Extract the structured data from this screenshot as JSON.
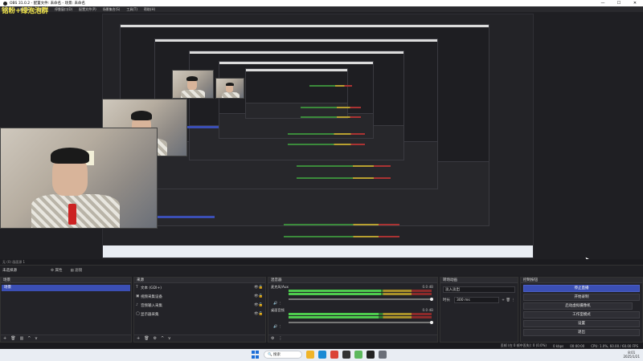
{
  "window": {
    "title": "OBS 31.0.2 - 配置文件: 未命名 - 场景: 未命名",
    "controls": [
      "—",
      "☐",
      "✕"
    ]
  },
  "menu": {
    "items": [
      "文件(F)",
      "编辑(E)",
      "视图(V)",
      "停靠窗口(D)",
      "配置文件(P)",
      "场景集合(S)",
      "工具(T)",
      "帮助(H)"
    ]
  },
  "overlay": {
    "small_text": "",
    "main_text": "铭粉+绿泡泡群"
  },
  "scene_bar": {
    "text": "无 (0) 画面源 1"
  },
  "mode_bar": {
    "label": "未选择源",
    "properties_label": "属性",
    "filters_label": "滤镜"
  },
  "scenes_dock": {
    "title": "场景",
    "items": [
      "场景"
    ],
    "footer": [
      "+",
      "🗑",
      "▥",
      "^",
      "v"
    ]
  },
  "sources_dock": {
    "title": "来源",
    "items": [
      {
        "icon": "T",
        "name": "文本 (GDI+)"
      },
      {
        "icon": "▣",
        "name": "视频采集设备"
      },
      {
        "icon": "♪",
        "name": "音频输入采集"
      },
      {
        "icon": "◯",
        "name": "显示器采集"
      }
    ],
    "footer": [
      "+",
      "🗑",
      "⚙",
      "^",
      "v"
    ]
  },
  "mixer_dock": {
    "title": "混音器",
    "channels": [
      {
        "name": "麦克风/Aux",
        "db": "0.0 dB",
        "level": 0.64
      },
      {
        "name": "桌面音频",
        "db": "0.0 dB",
        "level": 0.62
      }
    ],
    "footer": [
      "⚙",
      "⋮"
    ]
  },
  "transitions_dock": {
    "title": "转场动画",
    "type": "淡入淡出",
    "duration_label": "时长",
    "duration_value": "300 ms"
  },
  "controls_dock": {
    "title": "控制按钮",
    "buttons": [
      "停止直播",
      "开始录制",
      "启动虚拟摄像机",
      "工作室模式",
      "设置",
      "退出"
    ]
  },
  "statusbar": {
    "dropped": "丢帧 (在 0 帧中丢失): 0 (0.0%)",
    "network": "0 kbps",
    "rec_time": "00:00:00",
    "cpu": "CPU: 1.0%, 60.00 / 60.00 FPS"
  },
  "taskbar": {
    "search_placeholder": "搜索",
    "time": "8:01",
    "date": "2025/1/21",
    "icons": [
      {
        "name": "file-explorer-icon",
        "color": "#f0b429"
      },
      {
        "name": "edge-icon",
        "color": "#1a8ad4"
      },
      {
        "name": "chrome-icon",
        "color": "#db4437"
      },
      {
        "name": "obs-icon",
        "color": "#333333"
      },
      {
        "name": "app-icon",
        "color": "#5cb85c"
      },
      {
        "name": "terminal-icon",
        "color": "#222222"
      },
      {
        "name": "settings-icon",
        "color": "#6b6f78"
      }
    ]
  },
  "colors": {
    "accent": "#3b4fb5",
    "overlay_text": "#f2e64a",
    "panel_bg": "#232328"
  }
}
